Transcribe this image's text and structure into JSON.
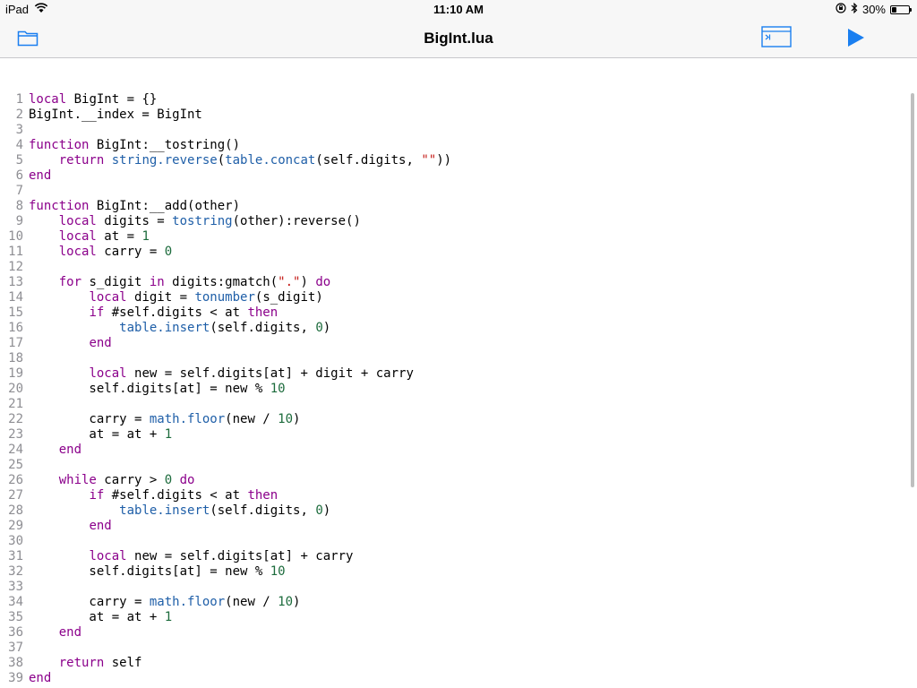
{
  "status": {
    "device": "iPad",
    "time": "11:10 AM",
    "battery": "30%",
    "battery_level": 0.3
  },
  "nav": {
    "title": "BigInt.lua"
  },
  "icons": {
    "folder": "folder-icon",
    "console": "console-icon",
    "run": "play-icon",
    "wifi": "wifi-icon",
    "bluetooth": "bluetooth-icon",
    "lock": "orientation-lock-icon",
    "battery": "battery-icon"
  },
  "colors": {
    "keyword": "#8b008b",
    "function": "#1f5fa8",
    "string": "#c41a16",
    "number": "#1c6b3c",
    "accent": "#1a7ff0"
  },
  "code": [
    {
      "n": "1",
      "tokens": [
        [
          "kw",
          "local"
        ],
        [
          "p",
          " BigInt = {}"
        ]
      ]
    },
    {
      "n": "2",
      "tokens": [
        [
          "p",
          "BigInt.__index = BigInt"
        ]
      ]
    },
    {
      "n": "3",
      "tokens": []
    },
    {
      "n": "4",
      "tokens": [
        [
          "kw",
          "function"
        ],
        [
          "p",
          " BigInt:__tostring()"
        ]
      ]
    },
    {
      "n": "5",
      "tokens": [
        [
          "p",
          "    "
        ],
        [
          "kw",
          "return"
        ],
        [
          "p",
          " "
        ],
        [
          "fn",
          "string.reverse"
        ],
        [
          "p",
          "("
        ],
        [
          "fn",
          "table.concat"
        ],
        [
          "p",
          "(self.digits, "
        ],
        [
          "str",
          "\"\""
        ],
        [
          "p",
          "))"
        ]
      ]
    },
    {
      "n": "6",
      "tokens": [
        [
          "kw",
          "end"
        ]
      ]
    },
    {
      "n": "7",
      "tokens": []
    },
    {
      "n": "8",
      "tokens": [
        [
          "kw",
          "function"
        ],
        [
          "p",
          " BigInt:__add(other)"
        ]
      ]
    },
    {
      "n": "9",
      "tokens": [
        [
          "p",
          "    "
        ],
        [
          "kw",
          "local"
        ],
        [
          "p",
          " digits = "
        ],
        [
          "fn",
          "tostring"
        ],
        [
          "p",
          "(other):reverse()"
        ]
      ]
    },
    {
      "n": "10",
      "tokens": [
        [
          "p",
          "    "
        ],
        [
          "kw",
          "local"
        ],
        [
          "p",
          " at = "
        ],
        [
          "num",
          "1"
        ]
      ]
    },
    {
      "n": "11",
      "tokens": [
        [
          "p",
          "    "
        ],
        [
          "kw",
          "local"
        ],
        [
          "p",
          " carry = "
        ],
        [
          "num",
          "0"
        ]
      ]
    },
    {
      "n": "12",
      "tokens": []
    },
    {
      "n": "13",
      "tokens": [
        [
          "p",
          "    "
        ],
        [
          "kw",
          "for"
        ],
        [
          "p",
          " s_digit "
        ],
        [
          "kw",
          "in"
        ],
        [
          "p",
          " digits:gmatch("
        ],
        [
          "str",
          "\".\""
        ],
        [
          "p",
          ") "
        ],
        [
          "kw",
          "do"
        ]
      ]
    },
    {
      "n": "14",
      "tokens": [
        [
          "p",
          "        "
        ],
        [
          "kw",
          "local"
        ],
        [
          "p",
          " digit = "
        ],
        [
          "fn",
          "tonumber"
        ],
        [
          "p",
          "(s_digit)"
        ]
      ]
    },
    {
      "n": "15",
      "tokens": [
        [
          "p",
          "        "
        ],
        [
          "kw",
          "if"
        ],
        [
          "p",
          " #self.digits < at "
        ],
        [
          "kw",
          "then"
        ]
      ]
    },
    {
      "n": "16",
      "tokens": [
        [
          "p",
          "            "
        ],
        [
          "fn",
          "table.insert"
        ],
        [
          "p",
          "(self.digits, "
        ],
        [
          "num",
          "0"
        ],
        [
          "p",
          ")"
        ]
      ]
    },
    {
      "n": "17",
      "tokens": [
        [
          "p",
          "        "
        ],
        [
          "kw",
          "end"
        ]
      ]
    },
    {
      "n": "18",
      "tokens": []
    },
    {
      "n": "19",
      "tokens": [
        [
          "p",
          "        "
        ],
        [
          "kw",
          "local"
        ],
        [
          "p",
          " new = self.digits[at] + digit + carry"
        ]
      ]
    },
    {
      "n": "20",
      "tokens": [
        [
          "p",
          "        self.digits[at] = new % "
        ],
        [
          "num",
          "10"
        ]
      ]
    },
    {
      "n": "21",
      "tokens": []
    },
    {
      "n": "22",
      "tokens": [
        [
          "p",
          "        carry = "
        ],
        [
          "fn",
          "math.floor"
        ],
        [
          "p",
          "(new / "
        ],
        [
          "num",
          "10"
        ],
        [
          "p",
          ")"
        ]
      ]
    },
    {
      "n": "23",
      "tokens": [
        [
          "p",
          "        at = at + "
        ],
        [
          "num",
          "1"
        ]
      ]
    },
    {
      "n": "24",
      "tokens": [
        [
          "p",
          "    "
        ],
        [
          "kw",
          "end"
        ]
      ]
    },
    {
      "n": "25",
      "tokens": []
    },
    {
      "n": "26",
      "tokens": [
        [
          "p",
          "    "
        ],
        [
          "kw",
          "while"
        ],
        [
          "p",
          " carry > "
        ],
        [
          "num",
          "0"
        ],
        [
          "p",
          " "
        ],
        [
          "kw",
          "do"
        ]
      ]
    },
    {
      "n": "27",
      "tokens": [
        [
          "p",
          "        "
        ],
        [
          "kw",
          "if"
        ],
        [
          "p",
          " #self.digits < at "
        ],
        [
          "kw",
          "then"
        ]
      ]
    },
    {
      "n": "28",
      "tokens": [
        [
          "p",
          "            "
        ],
        [
          "fn",
          "table.insert"
        ],
        [
          "p",
          "(self.digits, "
        ],
        [
          "num",
          "0"
        ],
        [
          "p",
          ")"
        ]
      ]
    },
    {
      "n": "29",
      "tokens": [
        [
          "p",
          "        "
        ],
        [
          "kw",
          "end"
        ]
      ]
    },
    {
      "n": "30",
      "tokens": []
    },
    {
      "n": "31",
      "tokens": [
        [
          "p",
          "        "
        ],
        [
          "kw",
          "local"
        ],
        [
          "p",
          " new = self.digits[at] + carry"
        ]
      ]
    },
    {
      "n": "32",
      "tokens": [
        [
          "p",
          "        self.digits[at] = new % "
        ],
        [
          "num",
          "10"
        ]
      ]
    },
    {
      "n": "33",
      "tokens": []
    },
    {
      "n": "34",
      "tokens": [
        [
          "p",
          "        carry = "
        ],
        [
          "fn",
          "math.floor"
        ],
        [
          "p",
          "(new / "
        ],
        [
          "num",
          "10"
        ],
        [
          "p",
          ")"
        ]
      ]
    },
    {
      "n": "35",
      "tokens": [
        [
          "p",
          "        at = at + "
        ],
        [
          "num",
          "1"
        ]
      ]
    },
    {
      "n": "36",
      "tokens": [
        [
          "p",
          "    "
        ],
        [
          "kw",
          "end"
        ]
      ]
    },
    {
      "n": "37",
      "tokens": []
    },
    {
      "n": "38",
      "tokens": [
        [
          "p",
          "    "
        ],
        [
          "kw",
          "return"
        ],
        [
          "p",
          " self"
        ]
      ]
    },
    {
      "n": "39",
      "tokens": [
        [
          "kw",
          "end"
        ]
      ]
    }
  ]
}
